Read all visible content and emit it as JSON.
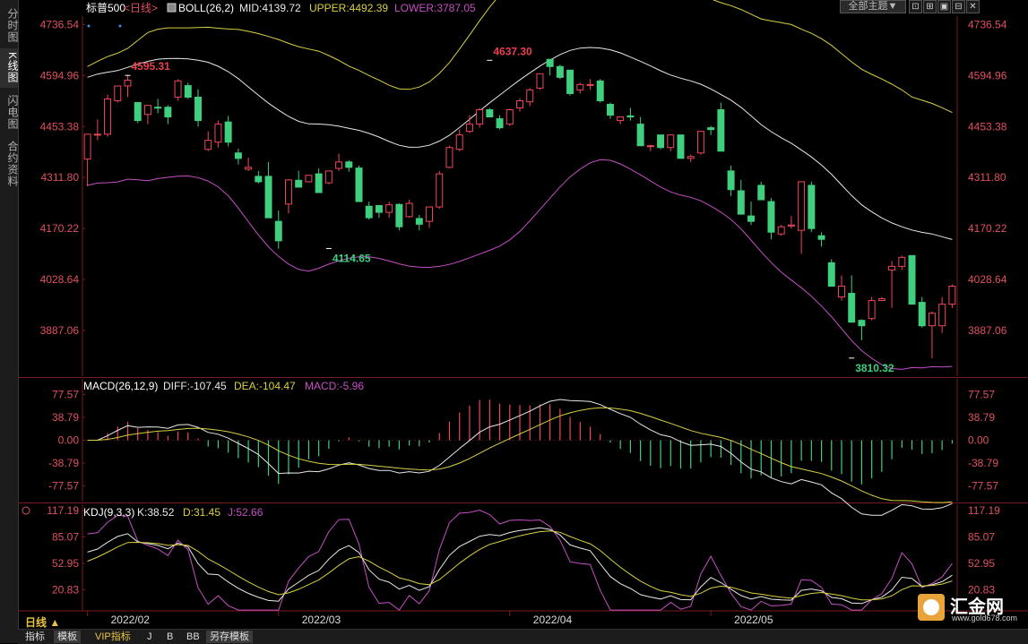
{
  "sidebar": {
    "tabs": [
      {
        "label": "分时图",
        "active": false
      },
      {
        "label": "K线图",
        "active": true
      },
      {
        "label": "闪电图",
        "active": false
      },
      {
        "label": "合约资料",
        "active": false
      }
    ]
  },
  "header": {
    "symbol": "标普500",
    "period": "<日线>",
    "indicator": "BOLL(26,2)",
    "mid": "MID:4139.72",
    "upper": "UPPER:4492.39",
    "lower": "LOWER:3787.05"
  },
  "toolbar": {
    "theme_label": "全部主题▼",
    "buttons": [
      "⊡",
      "⊞",
      "▣",
      "⊟",
      "✕"
    ]
  },
  "macd_header": {
    "label": "MACD(26,12,9)",
    "diff": "DIFF:-107.45",
    "dea": "DEA:-104.47",
    "macd": "MACD:-5.96"
  },
  "kdj_header": {
    "label": "KDJ(9,3,3)",
    "k": "K:38.52",
    "d": "D:31.45",
    "j": "J:52.66"
  },
  "bottom": {
    "period_tab": "日线 ▲",
    "tabs": [
      "指标",
      "模板",
      "VIP指标",
      "J",
      "B",
      "BB",
      "另存模板"
    ]
  },
  "logo": {
    "name": "汇金网",
    "url": "www.gold678.com"
  },
  "colors": {
    "up": "#f0475a",
    "down": "#3fcf7f",
    "mid": "#e8e8e8",
    "upper": "#d8d040",
    "lower": "#c54fc5",
    "axis": "#e05060",
    "grid": "#3a1212"
  },
  "chart_data": {
    "type": "candlestick",
    "dates": [
      "2022-02-01",
      "2022-02-02",
      "2022-02-03",
      "2022-02-04",
      "2022-02-07",
      "2022-02-08",
      "2022-02-09",
      "2022-02-10",
      "2022-02-11",
      "2022-02-14",
      "2022-02-15",
      "2022-02-16",
      "2022-02-17",
      "2022-02-18",
      "2022-02-22",
      "2022-02-23",
      "2022-02-24",
      "2022-02-25",
      "2022-02-28",
      "2022-03-01",
      "2022-03-02",
      "2022-03-03",
      "2022-03-04",
      "2022-03-07",
      "2022-03-08",
      "2022-03-09",
      "2022-03-10",
      "2022-03-11",
      "2022-03-14",
      "2022-03-15",
      "2022-03-16",
      "2022-03-17",
      "2022-03-18",
      "2022-03-21",
      "2022-03-22",
      "2022-03-23",
      "2022-03-24",
      "2022-03-25",
      "2022-03-28",
      "2022-03-29",
      "2022-03-30",
      "2022-03-31",
      "2022-04-01",
      "2022-04-04",
      "2022-04-05",
      "2022-04-06",
      "2022-04-07",
      "2022-04-08",
      "2022-04-11",
      "2022-04-12",
      "2022-04-13",
      "2022-04-14",
      "2022-04-18",
      "2022-04-19",
      "2022-04-20",
      "2022-04-21",
      "2022-04-22",
      "2022-04-25",
      "2022-04-26",
      "2022-04-27",
      "2022-04-28",
      "2022-04-29",
      "2022-05-02",
      "2022-05-03",
      "2022-05-04",
      "2022-05-05",
      "2022-05-06",
      "2022-05-09",
      "2022-05-10",
      "2022-05-11",
      "2022-05-12",
      "2022-05-13",
      "2022-05-16",
      "2022-05-17",
      "2022-05-18",
      "2022-05-19",
      "2022-05-20",
      "2022-05-23"
    ],
    "ohlc": [
      [
        4363,
        4432,
        4287,
        4432
      ],
      [
        4432,
        4473,
        4415,
        4432
      ],
      [
        4432,
        4542,
        4425,
        4530
      ],
      [
        4525,
        4566,
        4520,
        4566
      ],
      [
        4566,
        4596,
        4535,
        4582
      ],
      [
        4520,
        4520,
        4463,
        4470
      ],
      [
        4487,
        4512,
        4460,
        4512
      ],
      [
        4507,
        4530,
        4490,
        4505
      ],
      [
        4507,
        4513,
        4460,
        4480
      ],
      [
        4535,
        4585,
        4525,
        4580
      ],
      [
        4567,
        4575,
        4530,
        4535
      ],
      [
        4535,
        4557,
        4453,
        4470
      ],
      [
        4390,
        4440,
        4385,
        4415
      ],
      [
        4410,
        4470,
        4395,
        4460
      ],
      [
        4466,
        4483,
        4398,
        4410
      ],
      [
        4380,
        4392,
        4348,
        4365
      ],
      [
        4335,
        4367,
        4330,
        4340
      ],
      [
        4315,
        4330,
        4295,
        4300
      ],
      [
        4315,
        4355,
        4200,
        4200
      ],
      [
        4190,
        4220,
        4114,
        4136
      ],
      [
        4238,
        4307,
        4212,
        4305
      ],
      [
        4304,
        4330,
        4285,
        4285
      ],
      [
        4300,
        4318,
        4298,
        4318
      ],
      [
        4322,
        4338,
        4270,
        4270
      ],
      [
        4297,
        4330,
        4293,
        4330
      ],
      [
        4337,
        4378,
        4330,
        4355
      ],
      [
        4355,
        4360,
        4328,
        4340
      ],
      [
        4338,
        4345,
        4245,
        4245
      ],
      [
        4232,
        4245,
        4195,
        4200
      ],
      [
        4234,
        4234,
        4200,
        4215
      ],
      [
        4215,
        4245,
        4200,
        4236
      ],
      [
        4237,
        4240,
        4165,
        4175
      ],
      [
        4203,
        4250,
        4200,
        4240
      ],
      [
        4198,
        4208,
        4165,
        4182
      ],
      [
        4190,
        4230,
        4172,
        4230
      ],
      [
        4230,
        4330,
        4225,
        4322
      ],
      [
        4340,
        4400,
        4338,
        4395
      ],
      [
        4390,
        4445,
        4385,
        4430
      ],
      [
        4440,
        4485,
        4435,
        4460
      ],
      [
        4460,
        4505,
        4450,
        4500
      ],
      [
        4500,
        4505,
        4480,
        4480
      ],
      [
        4475,
        4485,
        4445,
        4450
      ],
      [
        4460,
        4503,
        4455,
        4500
      ],
      [
        4505,
        4532,
        4495,
        4525
      ],
      [
        4522,
        4560,
        4510,
        4555
      ],
      [
        4560,
        4600,
        4555,
        4600
      ],
      [
        4640,
        4640,
        4595,
        4620
      ],
      [
        4620,
        4625,
        4585,
        4590
      ],
      [
        4610,
        4610,
        4540,
        4545
      ],
      [
        4555,
        4575,
        4545,
        4570
      ],
      [
        4570,
        4585,
        4555,
        4570
      ],
      [
        4580,
        4585,
        4520,
        4525
      ],
      [
        4515,
        4520,
        4475,
        4485
      ],
      [
        4470,
        4480,
        4460,
        4480
      ],
      [
        4483,
        4505,
        4470,
        4480
      ],
      [
        4460,
        4480,
        4400,
        4400
      ],
      [
        4400,
        4402,
        4385,
        4400
      ],
      [
        4430,
        4430,
        4390,
        4395
      ],
      [
        4395,
        4430,
        4385,
        4430
      ],
      [
        4430,
        4430,
        4365,
        4365
      ],
      [
        4365,
        4375,
        4355,
        4370
      ],
      [
        4380,
        4440,
        4375,
        4440
      ],
      [
        4450,
        4455,
        4430,
        4445
      ],
      [
        4500,
        4520,
        4385,
        4385
      ],
      [
        4330,
        4345,
        4260,
        4278
      ],
      [
        4275,
        4305,
        4210,
        4210
      ],
      [
        4205,
        4245,
        4180,
        4190
      ],
      [
        4290,
        4300,
        4250,
        4250
      ],
      [
        4245,
        4255,
        4140,
        4160
      ],
      [
        4155,
        4180,
        4150,
        4175
      ],
      [
        4177,
        4205,
        4170,
        4180
      ],
      [
        4165,
        4300,
        4100,
        4300
      ],
      [
        4290,
        4300,
        4160,
        4170
      ],
      [
        4150,
        4160,
        4120,
        4140
      ],
      [
        4075,
        4085,
        4010,
        4010
      ],
      [
        3980,
        4040,
        3970,
        4010
      ],
      [
        3990,
        4040,
        3910,
        3910
      ],
      [
        3915,
        3918,
        3860,
        3900
      ],
      [
        3920,
        3980,
        3915,
        3970
      ],
      [
        3970,
        3980,
        3970,
        3975
      ],
      [
        4055,
        4080,
        3950,
        4065
      ],
      [
        4065,
        4095,
        4055,
        4090
      ],
      [
        4095,
        4096,
        3960,
        3960
      ],
      [
        3965,
        3980,
        3895,
        3900
      ],
      [
        3900,
        3940,
        3810,
        3935
      ],
      [
        3900,
        3980,
        3880,
        3960
      ],
      [
        3960,
        4015,
        3950,
        4010
      ]
    ],
    "boll": {
      "upper_start": 4620,
      "upper_peak": 4684,
      "upper_end": 4492.39,
      "mid_start": 4590,
      "mid_end": 4139.72,
      "lower_start": 4290,
      "lower_end": 3787.05
    },
    "price_axis": {
      "ticks": [
        4736.54,
        4594.96,
        4453.38,
        4311.8,
        4170.22,
        4028.64,
        3887.06
      ],
      "range": [
        3760,
        4760
      ]
    },
    "annotations": [
      {
        "label": "4595.31",
        "date": "2022-02-07",
        "value": 4595.31,
        "kind": "high"
      },
      {
        "label": "4637.30",
        "date": "2022-03-30",
        "value": 4637.3,
        "kind": "high"
      },
      {
        "label": "4114.65",
        "date": "2022-03-08",
        "value": 4114.65,
        "kind": "low"
      },
      {
        "label": "3810.32",
        "date": "2022-05-20",
        "value": 3810.32,
        "kind": "low"
      }
    ],
    "x_labels": [
      "2022/02",
      "2022/03",
      "2022/04",
      "2022/05"
    ],
    "macd_axis": {
      "ticks": [
        77.57,
        38.79,
        0.0,
        -38.79,
        -77.57
      ],
      "range": [
        -95,
        95
      ]
    },
    "kdj_axis": {
      "ticks": [
        117.19,
        85.07,
        52.95,
        20.83
      ],
      "range": [
        -5,
        125
      ]
    },
    "macd_last": {
      "diff": -107.45,
      "dea": -104.47,
      "macd": -5.96
    },
    "kdj_last": {
      "k": 38.52,
      "d": 31.45,
      "j": 52.66
    }
  }
}
